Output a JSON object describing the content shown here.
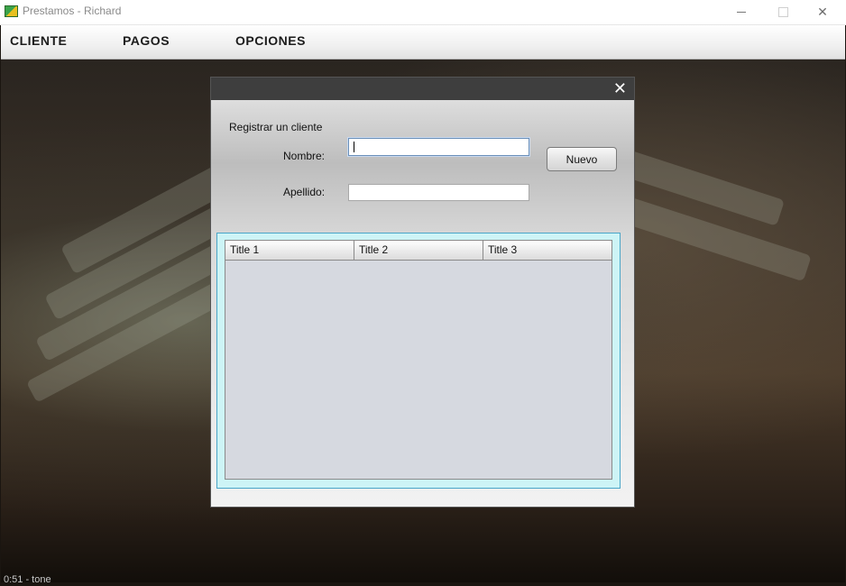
{
  "window": {
    "title": "Prestamos - Richard",
    "minimize_glyph": "—",
    "close_glyph": "✕"
  },
  "menu": {
    "items": [
      "CLIENTE",
      "PAGOS",
      "OPCIONES"
    ]
  },
  "dialog": {
    "close_glyph": "✕",
    "heading": "Registrar un cliente",
    "nombre_label": "Nombre:",
    "nombre_value": "",
    "apellido_label": "Apellido:",
    "apellido_value": "",
    "nuevo_button": "Nuevo",
    "table": {
      "columns": [
        "Title 1",
        "Title 2",
        "Title 3"
      ],
      "rows": []
    }
  },
  "status": {
    "text": "0:51 - tone"
  },
  "colors": {
    "dialog_titlebar": "#3e3e3e",
    "table_border": "#4aa6c8",
    "table_frame": "#cdf4f6",
    "table_body": "#d6d9e0"
  },
  "icons": {
    "app": "app-icon",
    "minimize": "minimize-icon",
    "maximize": "maximize-icon",
    "close": "close-icon"
  }
}
